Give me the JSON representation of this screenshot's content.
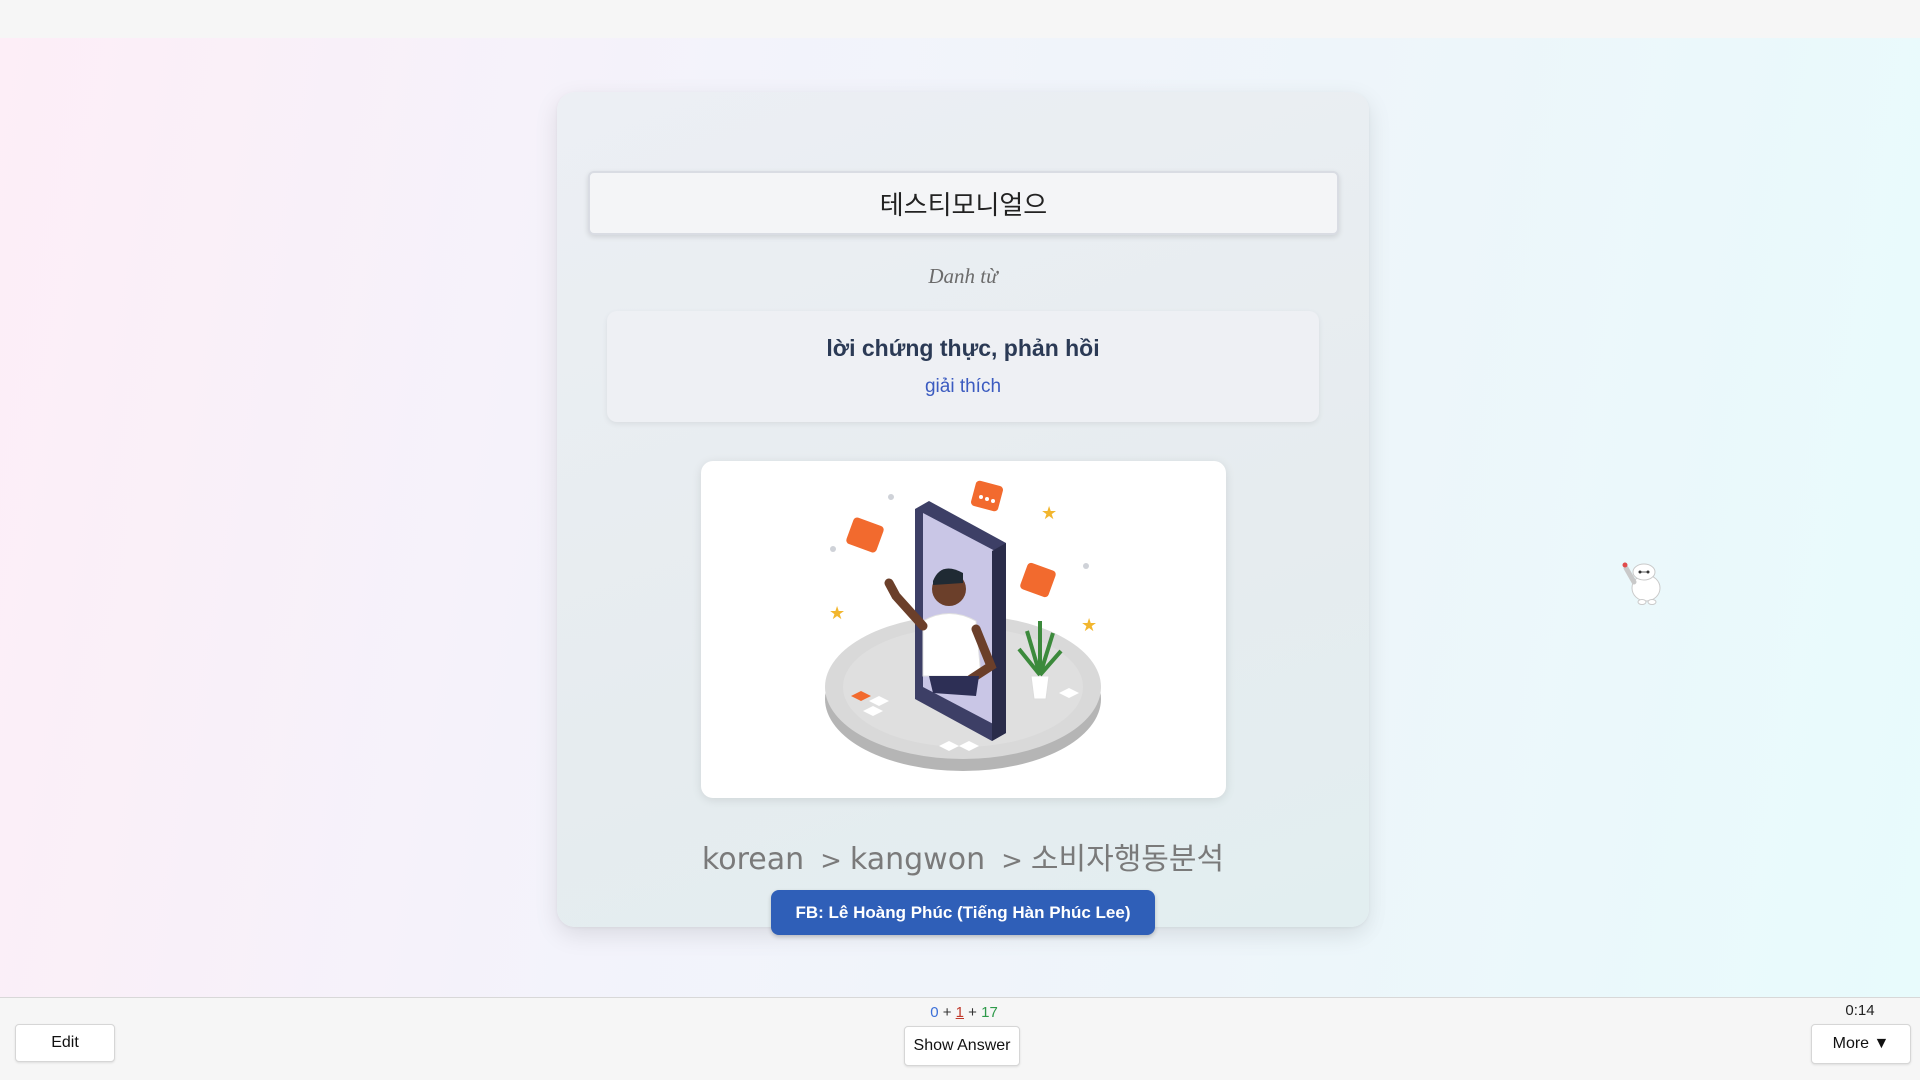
{
  "card": {
    "term": "테스티모니얼으",
    "part_of_speech": "Danh từ",
    "meaning": "lời chứng thực, phản hồi",
    "explain_link": "giải thích",
    "illustration": "person-waving-from-phone-with-chat-bubbles",
    "breadcrumb": [
      "korean",
      "kangwon",
      "소비자행동분석"
    ],
    "breadcrumb_separator": ">",
    "fb_button": "FB: Lê Hoàng Phúc (Tiếng Hàn Phúc Lee)"
  },
  "mascot": "baymax-waving-icon",
  "bottom": {
    "edit_label": "Edit",
    "show_answer_label": "Show Answer",
    "more_label": "More ▼",
    "counts": {
      "new": "0",
      "learning": "1",
      "review": "17",
      "plus": "+"
    },
    "timer": "0:14"
  },
  "colors": {
    "accent_button": "#2f5fb8",
    "new_count": "#3b6fd8",
    "learn_count": "#c0392b",
    "review_count": "#2e9a4a"
  }
}
